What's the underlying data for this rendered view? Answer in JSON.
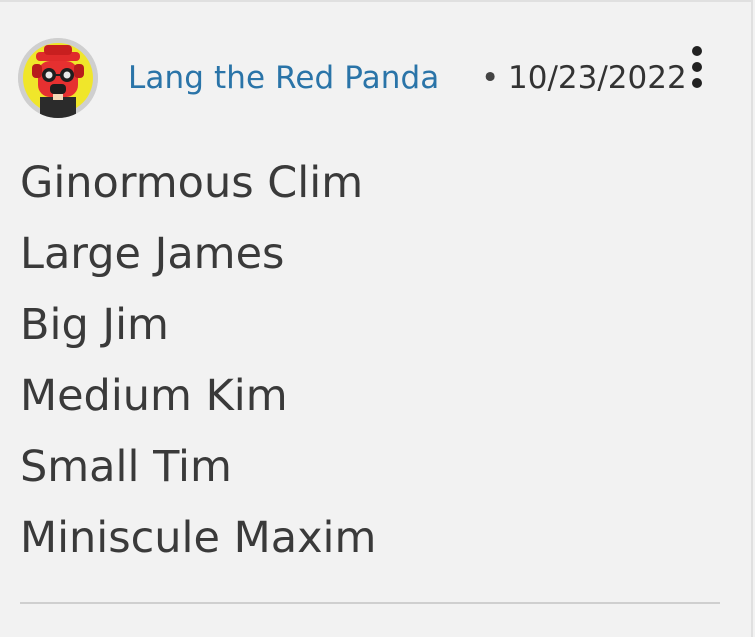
{
  "post": {
    "author": "Lang the Red Panda",
    "separator": "•",
    "date": "10/23/2022",
    "lines": [
      "Ginormous Clim",
      "Large James",
      "Big Jim",
      "Medium Kim",
      "Small Tim",
      "Miniscule Maxim"
    ]
  },
  "icons": {
    "avatar": "red-panda-avatar",
    "menu": "more-options-icon"
  },
  "colors": {
    "author_link": "#2a74a8",
    "text": "#3a3a3a",
    "background": "#f2f2f2",
    "avatar_background": "#f0e62a"
  }
}
